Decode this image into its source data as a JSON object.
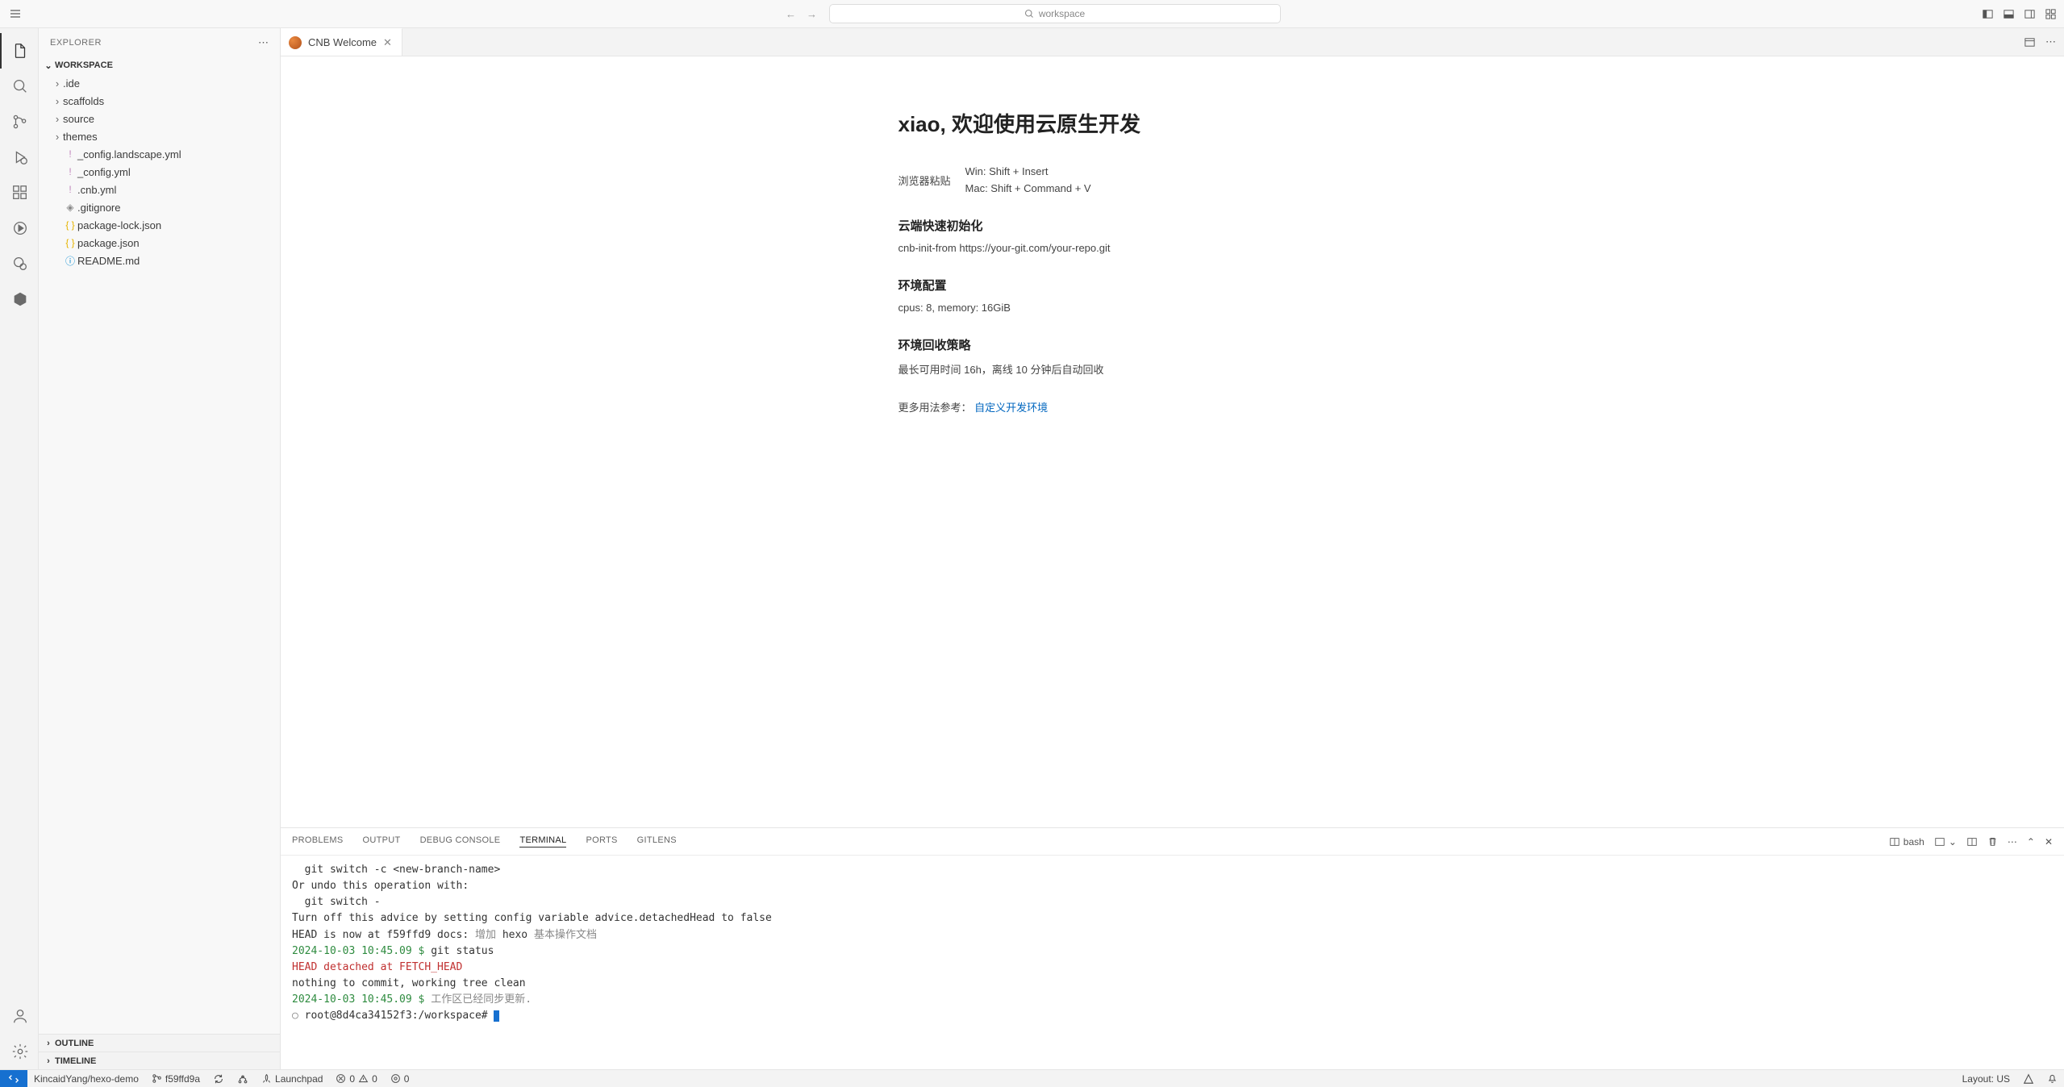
{
  "titlebar": {
    "search_text": "workspace"
  },
  "activitybar": [
    "files",
    "search",
    "scm",
    "debug",
    "extensions",
    "live",
    "share",
    "hex"
  ],
  "sidebar": {
    "title": "EXPLORER",
    "workspace_label": "WORKSPACE",
    "tree": [
      {
        "kind": "folder",
        "name": ".ide"
      },
      {
        "kind": "folder",
        "name": "scaffolds"
      },
      {
        "kind": "folder",
        "name": "source"
      },
      {
        "kind": "folder",
        "name": "themes"
      },
      {
        "kind": "file",
        "icon": "yml",
        "name": "_config.landscape.yml"
      },
      {
        "kind": "file",
        "icon": "yml",
        "name": "_config.yml"
      },
      {
        "kind": "file",
        "icon": "yml",
        "name": ".cnb.yml"
      },
      {
        "kind": "file",
        "icon": "git",
        "name": ".gitignore"
      },
      {
        "kind": "file",
        "icon": "json",
        "name": "package-lock.json"
      },
      {
        "kind": "file",
        "icon": "json",
        "name": "package.json"
      },
      {
        "kind": "file",
        "icon": "info",
        "name": "README.md"
      }
    ],
    "outline_label": "OUTLINE",
    "timeline_label": "TIMELINE"
  },
  "tab": {
    "label": "CNB Welcome"
  },
  "welcome": {
    "heading": "xiao, 欢迎使用云原生开发",
    "paste_label": "浏览器粘贴",
    "win_line": "Win: Shift  +  Insert",
    "mac_line": "Mac: Shift  +  Command  +  V",
    "init_heading": "云端快速初始化",
    "init_line": "cnb-init-from https://your-git.com/your-repo.git",
    "env_heading": "环境配置",
    "env_line": "cpus: 8, memory: 16GiB",
    "recycle_heading": "环境回收策略",
    "recycle_line": "最长可用时间 16h，离线 10 分钟后自动回收",
    "more_prefix": "更多用法参考：",
    "more_link": "自定义开发环境"
  },
  "panel": {
    "tabs": {
      "problems": "PROBLEMS",
      "output": "OUTPUT",
      "debug": "DEBUG CONSOLE",
      "terminal": "TERMINAL",
      "ports": "PORTS",
      "gitlens": "GITLENS"
    },
    "shell": "bash",
    "terminal_lines": [
      {
        "c": "",
        "t": "  git switch -c <new-branch-name>"
      },
      {
        "c": "",
        "t": ""
      },
      {
        "c": "",
        "t": "Or undo this operation with:"
      },
      {
        "c": "",
        "t": ""
      },
      {
        "c": "",
        "t": "  git switch -"
      },
      {
        "c": "",
        "t": ""
      },
      {
        "c": "",
        "t": "Turn off this advice by setting config variable advice.detachedHead to false"
      },
      {
        "c": "",
        "t": ""
      }
    ],
    "head_line_a": "HEAD is now at f59ffd9 docs: ",
    "head_line_b": "增加 ",
    "head_line_c": "hexo ",
    "head_line_d": "基本操作文档",
    "prompt1": "2024-10-03 10:45.09 $ ",
    "cmd1": "git status",
    "detached": "HEAD detached at FETCH_HEAD",
    "clean": "nothing to commit, working tree clean",
    "prompt2": "2024-10-03 10:45.09 $ ",
    "sync": "工作区已经同步更新.",
    "root": "root@8d4ca34152f3:/workspace# "
  },
  "status": {
    "repo": "KincaidYang/hexo-demo",
    "branch": "f59ffd9a",
    "launchpad": "Launchpad",
    "errors": "0",
    "warnings": "0",
    "ports": "0",
    "layout": "Layout: US"
  }
}
